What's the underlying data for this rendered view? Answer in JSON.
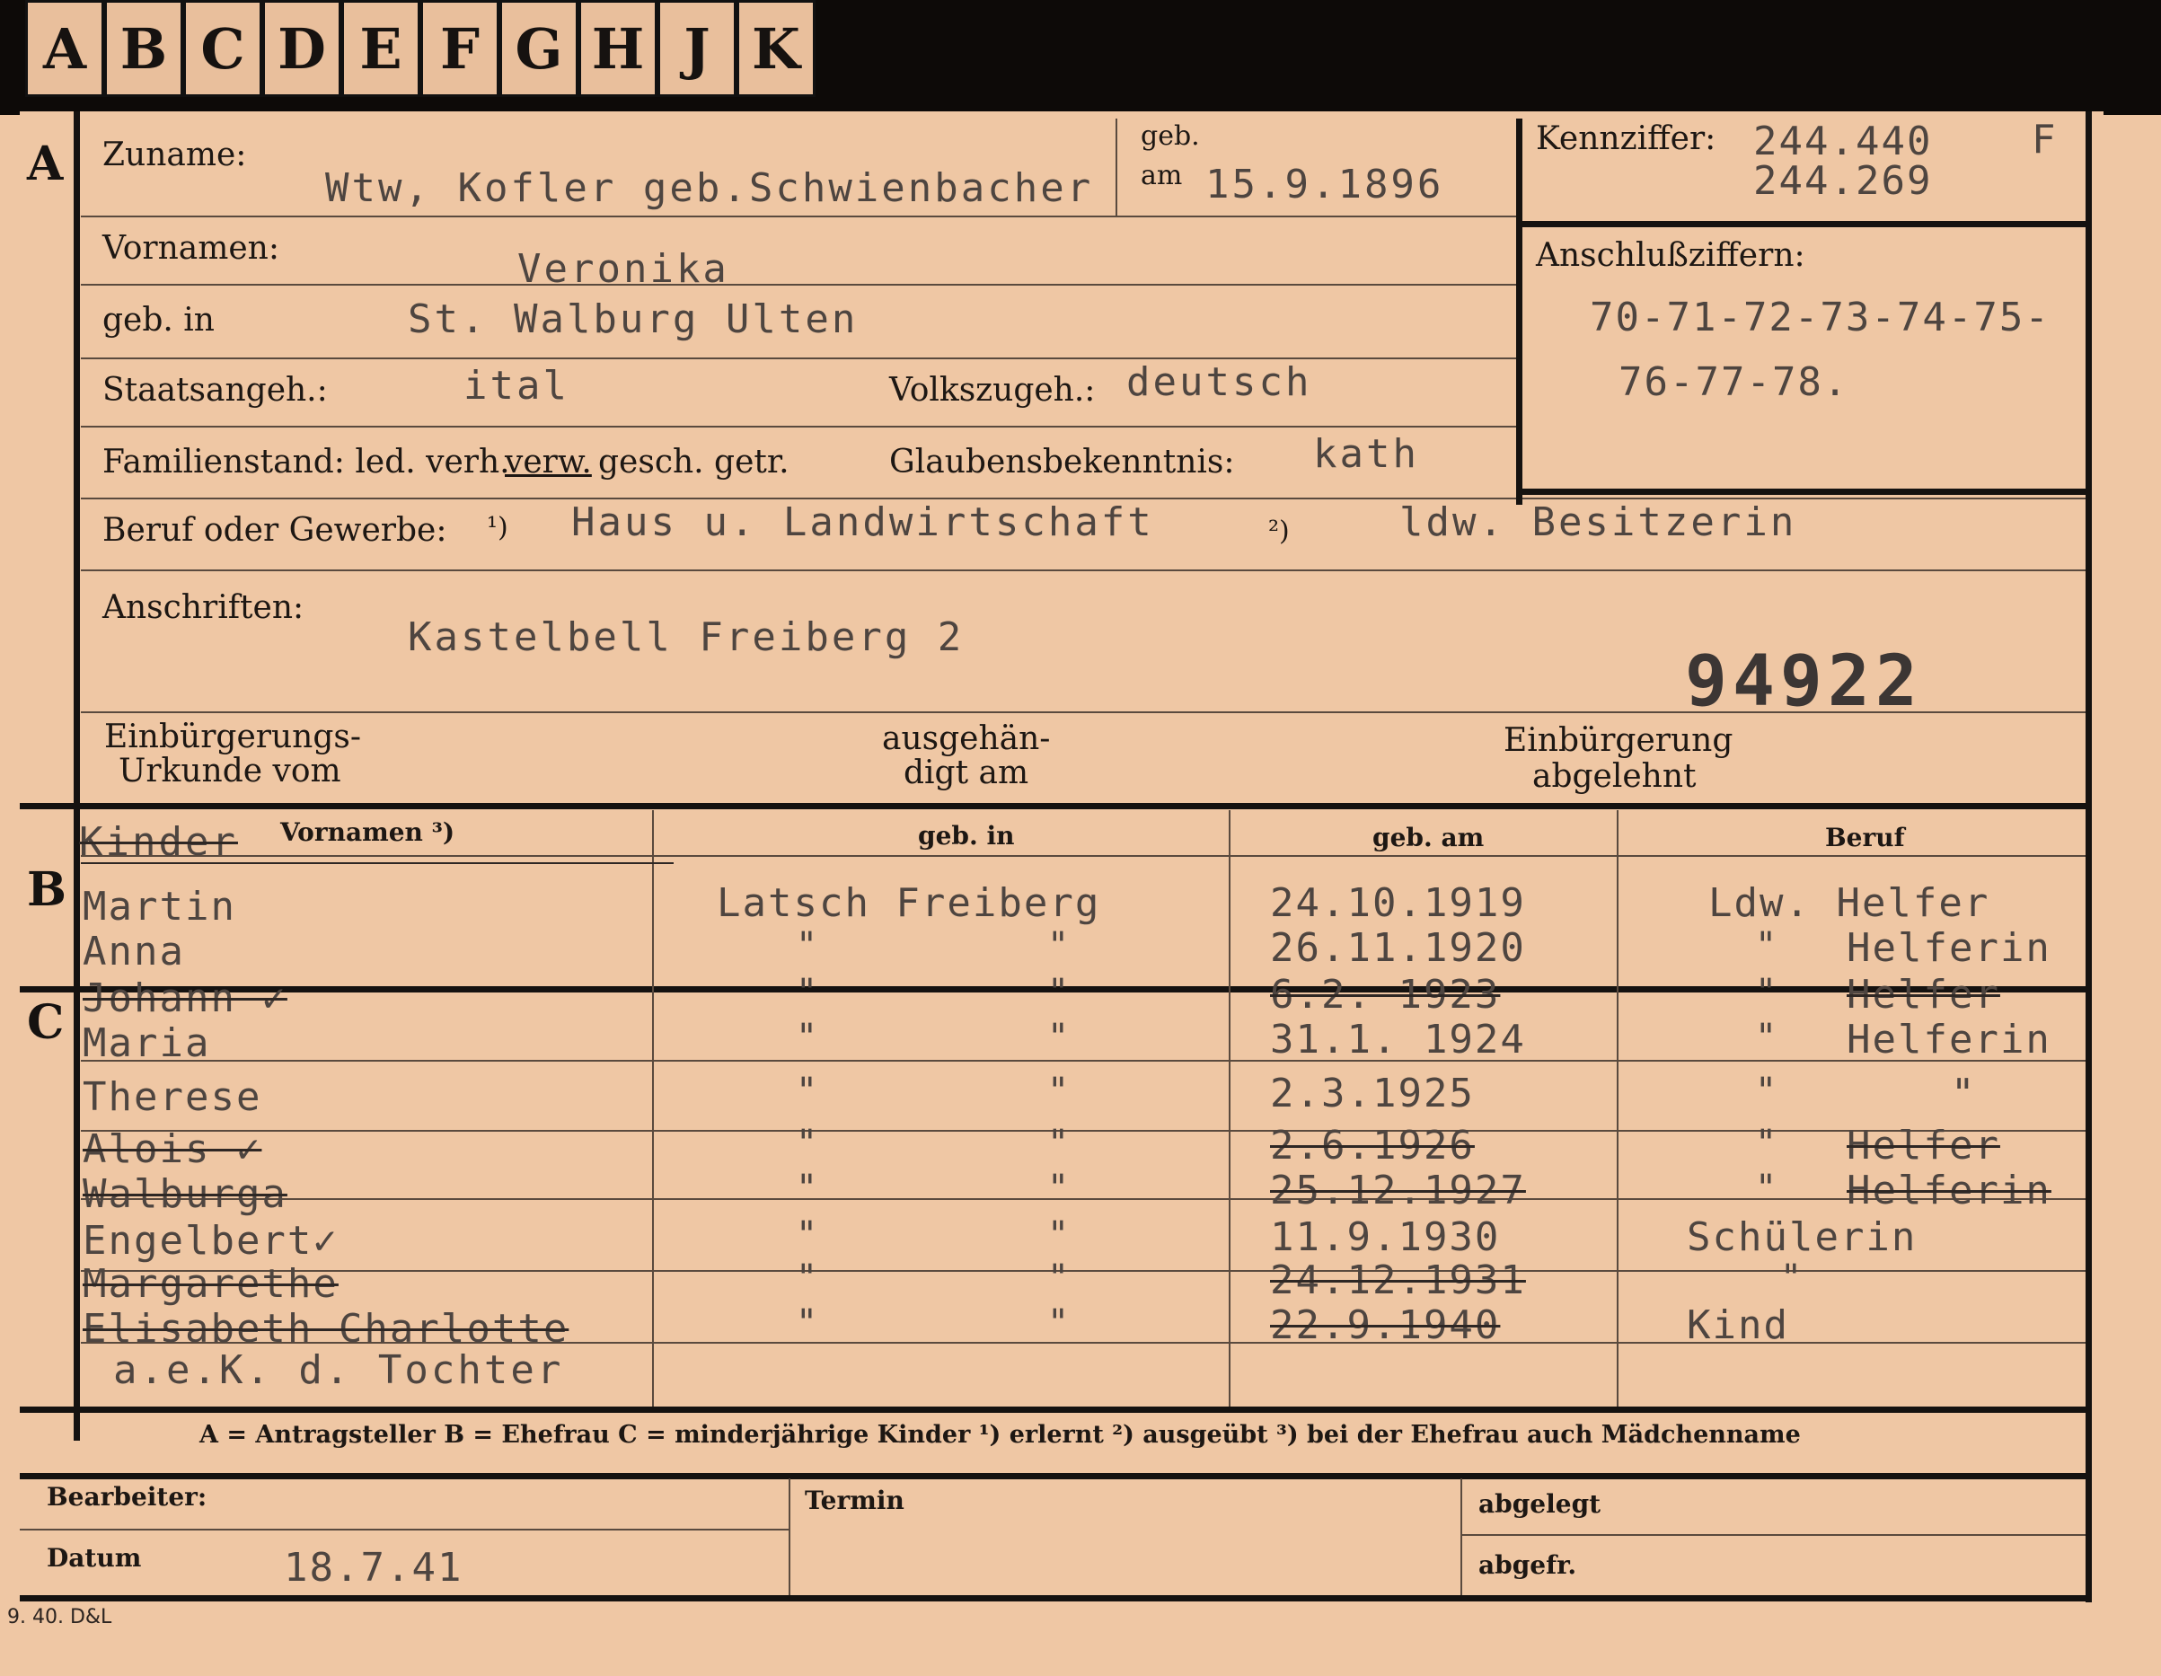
{
  "index_tabs": [
    "A",
    "B",
    "C",
    "D",
    "E",
    "F",
    "G",
    "H",
    "J",
    "K"
  ],
  "sections": {
    "a": "A",
    "b": "B",
    "c": "C"
  },
  "labels": {
    "zuname": "Zuname:",
    "geb": "geb.",
    "am": "am",
    "kennziffer": "Kennziffer:",
    "vornamen": "Vornamen:",
    "anschlussziffern": "Anschlußziffern:",
    "geb_in": "geb. in",
    "staatsangeh": "Staatsangeh.:",
    "volkszugeh": "Volkszugeh.:",
    "familienstand": "Familienstand: led. verh.",
    "verw": "verw.",
    "gesch_getr": "gesch. getr.",
    "glaubensbekenntnis": "Glaubensbekenntnis:",
    "beruf": "Beruf oder Gewerbe:",
    "marker1": "¹)",
    "marker2": "²)",
    "anschriften": "Anschriften:",
    "einbuergerungs_line1": "Einbürgerungs-",
    "einbuergerungs_line2": "Urkunde vom",
    "ausgehaend_line1": "ausgehän-",
    "ausgehaend_line2": "digt am",
    "einbuergerung_line1": "Einbürgerung",
    "einbuergerung_line2": "abgelehnt"
  },
  "person": {
    "zuname": "Wtw, Kofler geb.Schwienbacher",
    "geb_am": "15.9.1896",
    "kennziffer_1": "244.440",
    "kennziffer_flag": "F",
    "kennziffer_2": "244.269",
    "vornamen": "Veronika",
    "anschlussziffern_1": "70-71-72-73-74-75-",
    "anschlussziffern_2": "76-77-78.",
    "geb_in": "St. Walburg Ulten",
    "staatsangeh": "ital",
    "volkszugeh": "deutsch",
    "glaubensbekenntnis": "kath",
    "beruf_1": "Haus u. Landwirtschaft",
    "beruf_2": "ldw. Besitzerin",
    "anschrift": "Kastelbell Freiberg 2",
    "stamp_number": "94922"
  },
  "children_table": {
    "heading_typed": "Kinder",
    "headers": [
      "Vornamen ³)",
      "geb. in",
      "geb. am",
      "Beruf"
    ],
    "first_place": "Latsch Freiberg",
    "ditto": "\"",
    "rows": [
      {
        "name": "Martin",
        "born": "24.10.1919",
        "beruf": "Ldw. Helfer"
      },
      {
        "name": "Anna",
        "born": "26.11.1920",
        "beruf_ditto": "\"",
        "beruf": "Helferin"
      },
      {
        "name": "Johann ✓",
        "born": "6.2. 1923",
        "beruf_ditto": "\"",
        "beruf": "Helfer"
      },
      {
        "name": "Maria",
        "born": "31.1. 1924",
        "beruf_ditto": "\"",
        "beruf": "Helferin"
      },
      {
        "name": "Therese",
        "born": "2.3.1925",
        "beruf_ditto": "\"",
        "beruf": "\""
      },
      {
        "name": "Alois ✓",
        "born": "2.6.1926",
        "beruf_ditto": "\"",
        "beruf": "Helfer"
      },
      {
        "name": "Walburga",
        "born": "25.12.1927",
        "beruf_ditto": "\"",
        "beruf": "Helferin"
      },
      {
        "name": "Engelbert✓",
        "born": "11.9.1930",
        "beruf": "Schülerin"
      },
      {
        "name": "Margarethe",
        "born": "24.12.1931",
        "beruf": "\""
      },
      {
        "name": "Elisabeth Charlotte",
        "born": "22.9.1940",
        "beruf": "Kind"
      }
    ],
    "note": "a.e.K. d. Tochter"
  },
  "legend": "A = Antragsteller   B = Ehefrau   C = minderjährige Kinder   ¹) erlernt   ²) ausgeübt   ³) bei der Ehefrau auch Mädchenname",
  "footer": {
    "bearbeiter": "Bearbeiter:",
    "termin": "Termin",
    "abgelegt": "abgelegt",
    "datum": "Datum",
    "datum_value": "18.7.41",
    "abgefr": "abgefr.",
    "print_code": "9. 40. D&L"
  },
  "colors": {
    "paper": "#efc7a4",
    "ink": "#151210",
    "typewriter": "#4e4540"
  }
}
